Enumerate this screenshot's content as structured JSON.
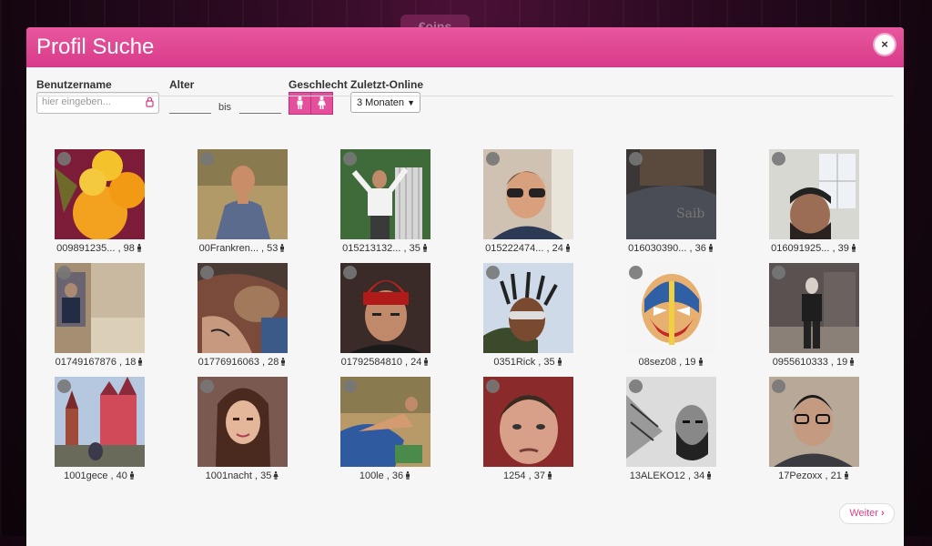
{
  "background_tab": "€oins",
  "modal": {
    "title": "Profil Suche",
    "close_label": "×"
  },
  "filters": {
    "username_label": "Benutzername",
    "username_placeholder": "hier eingeben...",
    "age_label": "Alter",
    "age_to": "bis",
    "gender_label": "Geschlecht",
    "last_online_label": "Zuletzt-Online",
    "last_online_value": "3 Monaten"
  },
  "profiles": [
    {
      "name": "009891235...",
      "age": "98",
      "icon": "male-icon",
      "photo": "oranges-fruit"
    },
    {
      "name": "00Frankren...",
      "age": "53",
      "icon": "male-icon",
      "photo": "man-field"
    },
    {
      "name": "015213132...",
      "age": "35",
      "icon": "male-icon",
      "photo": "man-gate"
    },
    {
      "name": "015222474...",
      "age": "24",
      "icon": "male-icon",
      "photo": "man-sunglasses"
    },
    {
      "name": "016030390...",
      "age": "36",
      "icon": "male-icon",
      "photo": "dark-shirt"
    },
    {
      "name": "016091925...",
      "age": "39",
      "icon": "male-icon",
      "photo": "man-window"
    },
    {
      "name": "01749167876",
      "age": "18",
      "icon": "male-icon",
      "photo": "mirror-room"
    },
    {
      "name": "01776916063",
      "age": "28",
      "icon": "male-icon",
      "photo": "tattoo-dog"
    },
    {
      "name": "01792584810",
      "age": "24",
      "icon": "male-icon",
      "photo": "red-beanie"
    },
    {
      "name": "0351Rick",
      "age": "35",
      "icon": "male-icon",
      "photo": "dreadlocks"
    },
    {
      "name": "08sez08",
      "age": "19",
      "icon": "male-icon",
      "photo": "wrestler-mask"
    },
    {
      "name": "0955610333",
      "age": "19",
      "icon": "male-icon",
      "photo": "hoodie-ruins"
    },
    {
      "name": "1001gece",
      "age": "40",
      "icon": "male-icon",
      "photo": "castle"
    },
    {
      "name": "1001nacht",
      "age": "35",
      "icon": "female-icon",
      "photo": "woman-brunette"
    },
    {
      "name": "100le",
      "age": "36",
      "icon": "male-icon",
      "photo": "beach-rock"
    },
    {
      "name": "1254",
      "age": "37",
      "icon": "male-icon",
      "photo": "man-closeup"
    },
    {
      "name": "13ALEKO12",
      "age": "34",
      "icon": "male-icon",
      "photo": "sketch-man"
    },
    {
      "name": "17Pezoxx",
      "age": "21",
      "icon": "male-icon",
      "photo": "glasses-man"
    }
  ],
  "pagination": {
    "next_label": "Weiter",
    "next_icon": "chevron-right-icon"
  },
  "colors": {
    "header_pink": "#e04b94",
    "accent": "#e23e8c"
  }
}
